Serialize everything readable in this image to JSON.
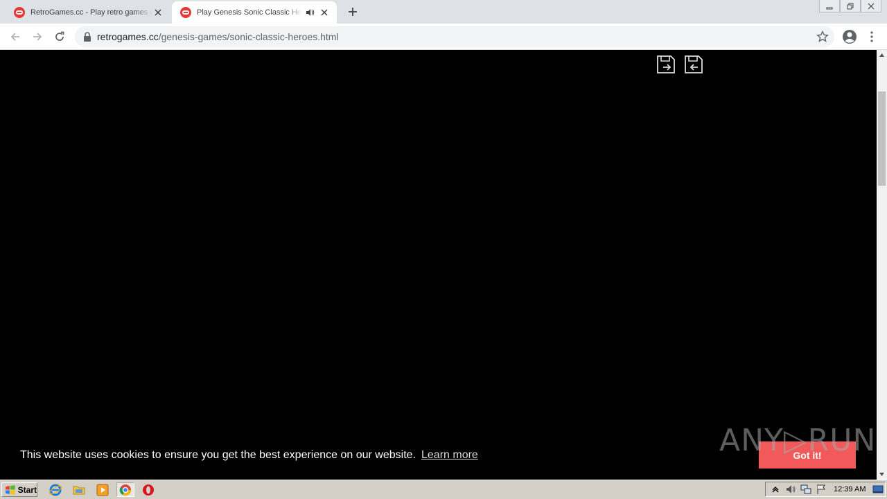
{
  "browser": {
    "tabs": [
      {
        "title": "RetroGames.cc - Play retro games online",
        "active": false
      },
      {
        "title": "Play Genesis Sonic Classic Heroes online",
        "active": true
      }
    ],
    "url": {
      "host": "retrogames.cc",
      "path": "/genesis-games/sonic-classic-heroes.html"
    }
  },
  "cookie_banner": {
    "message": "This website uses cookies to ensure you get the best experience on our website.",
    "learn_more": "Learn more",
    "accept": "Got it!"
  },
  "watermark": "ANY▷RUN",
  "taskbar": {
    "start_label": "Start",
    "clock": "12:39 AM"
  },
  "colors": {
    "accept_button": "#f1595b",
    "tab_favicon": "#e53935",
    "game_background": "#000000"
  }
}
